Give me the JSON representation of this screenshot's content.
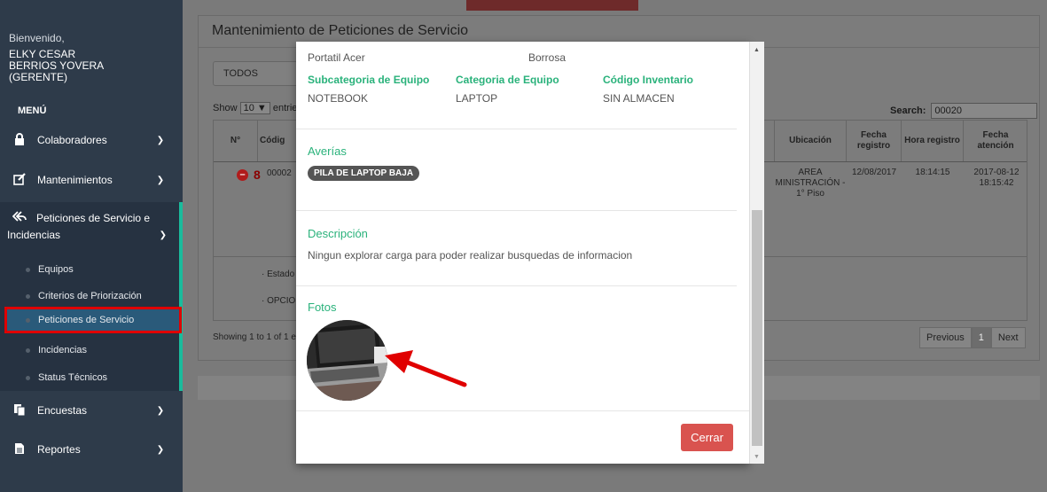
{
  "sidebar": {
    "welcome": "Bienvenido,",
    "user_line1": "ELKY CESAR",
    "user_line2": "BERRIOS YOVERA",
    "user_line3": "(GERENTE)",
    "menu_title": "MENÚ",
    "items": [
      {
        "label": "Colaboradores",
        "icon": "lock-icon"
      },
      {
        "label": "Mantenimientos",
        "icon": "edit-icon"
      },
      {
        "label_line1": "Peticiones de Servicio e",
        "label_line2": "Incidencias",
        "icon": "reply-all-icon"
      },
      {
        "label": "Encuestas",
        "icon": "copy-icon"
      },
      {
        "label": "Reportes",
        "icon": "file-icon"
      }
    ],
    "sub_items": [
      "Equipos",
      "Criterios de Priorización",
      "Peticiones de Servicio",
      "Incidencias",
      "Status Técnicos"
    ]
  },
  "page": {
    "title": "Mantenimiento de Peticiones de Servicio",
    "filter_value": "TODOS",
    "show_prefix": "Show",
    "show_value": "10",
    "show_suffix": "entrie",
    "search_label": "Search:",
    "search_value": "00020",
    "headers": {
      "num": "N°",
      "code": "Códig",
      "ubicacion": "Ubicación",
      "fecha_registro": "Fecha registro",
      "hora_registro": "Hora registro",
      "fecha_atencion": "Fecha atención"
    },
    "row": {
      "num": "8",
      "code": "00002",
      "ubicacion": "AREA MINISTRACIÓN - 1° Piso",
      "fecha_registro": "12/08/2017",
      "hora_registro": "18:14:15",
      "fecha_atencion": "2017-08-12 18:15:42"
    },
    "detail_1": "Estado",
    "detail_2": "OPCIO",
    "showing": "Showing 1 to 1 of 1 en",
    "pager": {
      "previous": "Previous",
      "page": "1",
      "next": "Next"
    }
  },
  "modal": {
    "equipo": "Portatil Acer",
    "estado": "Borrosa",
    "subcategoria_label": "Subcategoria de Equipo",
    "subcategoria_value": "NOTEBOOK",
    "categoria_label": "Categoria de Equipo",
    "categoria_value": "LAPTOP",
    "codigo_label": "Código Inventario",
    "codigo_value": "SIN ALMACEN",
    "averias_title": "Averías",
    "averia_badge": "PILA DE LAPTOP BAJA",
    "descripcion_title": "Descripción",
    "descripcion_value": "Ningun explorar carga para poder realizar busquedas de informacion",
    "fotos_title": "Fotos",
    "cerrar_label": "Cerrar"
  },
  "colors": {
    "accent": "#2ab27b",
    "danger": "#d9534f",
    "sidebar_bg": "#2e3b4a",
    "highlight": "#e00000"
  }
}
